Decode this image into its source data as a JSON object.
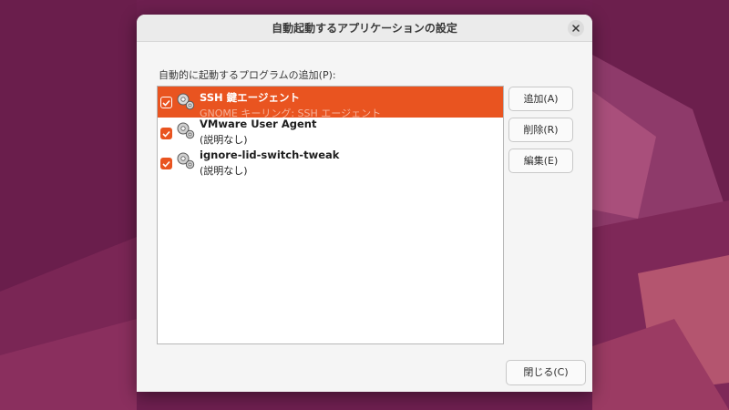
{
  "colors": {
    "accent": "#e95420",
    "desktop_bg": "#6b1f4e"
  },
  "dialog": {
    "title": "自動起動するアプリケーションの設定",
    "close_icon": "close-icon",
    "section_label": "自動的に起動するプログラムの追加(P):",
    "items": [
      {
        "name": "SSH 鍵エージェント",
        "description": "GNOME キーリング: SSH エージェント",
        "checked": true,
        "selected": true,
        "icon": "gears-icon"
      },
      {
        "name": "VMware User Agent",
        "description": "(説明なし)",
        "checked": true,
        "selected": false,
        "icon": "gears-icon"
      },
      {
        "name": "ignore-lid-switch-tweak",
        "description": "(説明なし)",
        "checked": true,
        "selected": false,
        "icon": "gears-icon"
      }
    ],
    "buttons": {
      "add": "追加(A)",
      "remove": "削除(R)",
      "edit": "編集(E)",
      "close": "閉じる(C)"
    }
  }
}
